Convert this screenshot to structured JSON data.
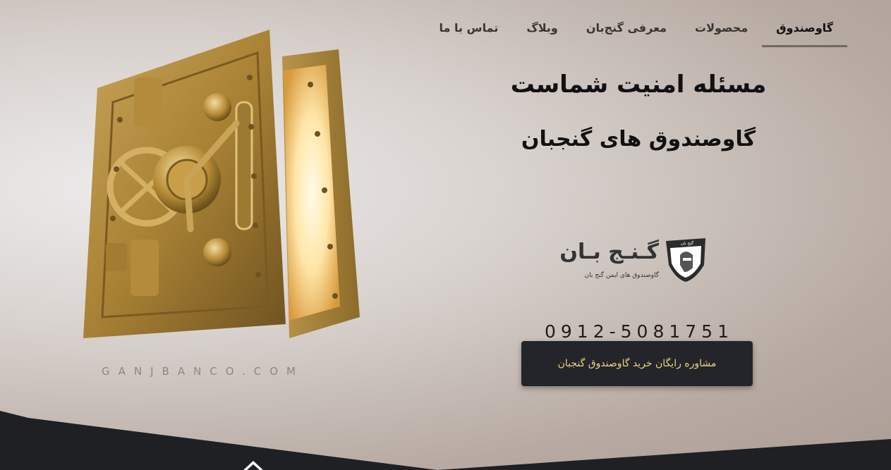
{
  "nav": {
    "items": [
      {
        "label": "گاوصندوق",
        "active": true
      },
      {
        "label": "محصولات",
        "active": false
      },
      {
        "label": "معرفی گنج‌بان",
        "active": false
      },
      {
        "label": "وبلاگ",
        "active": false
      },
      {
        "label": "تماس با ما",
        "active": false
      }
    ]
  },
  "hero": {
    "headline": "مسئله امنیت شماست",
    "subheadline": "گاوصندوق های گنجبان"
  },
  "logo": {
    "name": "گـنـج بـان",
    "tagline": "گاوصندوق های ایمن گنج بان",
    "badge_text": "گنج بان",
    "icon": "knight-helmet-shield-icon"
  },
  "contact": {
    "phone": "0912-5081751"
  },
  "cta": {
    "label": "مشاوره رایگان خرید گاوصندوق گنجبان"
  },
  "watermark": {
    "domain": "GANJBANCO.COM"
  },
  "footer": {
    "icon": "home-icon"
  },
  "colors": {
    "cta_bg": "#23252b",
    "cta_text": "#f0d27a",
    "band_dark": "#1f2024",
    "gold": "#b8903f"
  }
}
